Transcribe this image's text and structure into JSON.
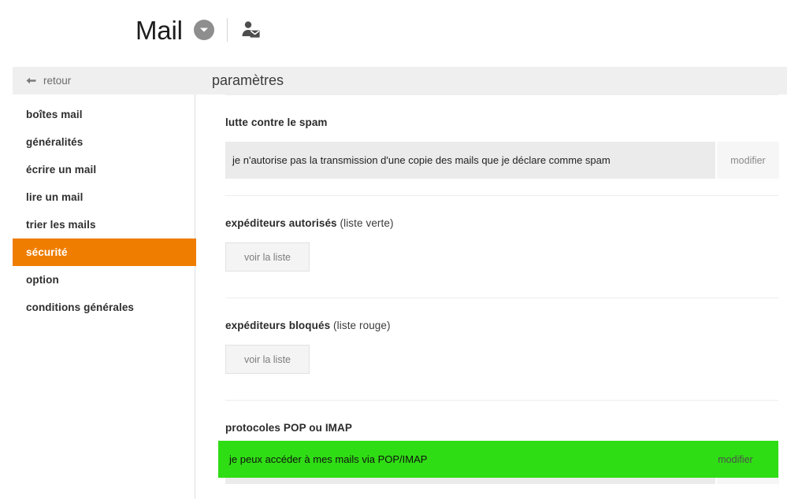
{
  "header": {
    "brand": "Mail",
    "caret_icon": "chevron-down-circle-icon",
    "account_icon": "user-mail-icon"
  },
  "subbar": {
    "back_label": "retour",
    "back_icon": "arrow-left-icon",
    "title": "paramètres"
  },
  "sidebar": {
    "items": [
      {
        "label": "boîtes mail",
        "active": false
      },
      {
        "label": "généralités",
        "active": false
      },
      {
        "label": "écrire un mail",
        "active": false
      },
      {
        "label": "lire un mail",
        "active": false
      },
      {
        "label": "trier les mails",
        "active": false
      },
      {
        "label": "sécurité",
        "active": true
      },
      {
        "label": "option",
        "active": false
      },
      {
        "label": "conditions générales",
        "active": false
      }
    ],
    "active_color": "#ef7d00"
  },
  "main": {
    "spam": {
      "title": "lutte contre le spam",
      "value": "je n'autorise pas la transmission d'une copie des mails que je déclare comme spam",
      "modify_label": "modifier"
    },
    "allowed": {
      "title_bold": "expéditeurs autorisés",
      "title_sub": "(liste verte)",
      "button_label": "voir la liste"
    },
    "blocked": {
      "title_bold": "expéditeurs bloqués",
      "title_sub": "(liste rouge)",
      "button_label": "voir la liste"
    },
    "protocols": {
      "title": "protocoles POP ou IMAP",
      "value": "je peux accéder à mes mails via POP/IMAP",
      "modify_label": "modifier"
    }
  },
  "highlight": {
    "color": "#2fdd14",
    "text": "je peux accéder à mes mails via POP/IMAP",
    "modify_label": "modifier"
  }
}
